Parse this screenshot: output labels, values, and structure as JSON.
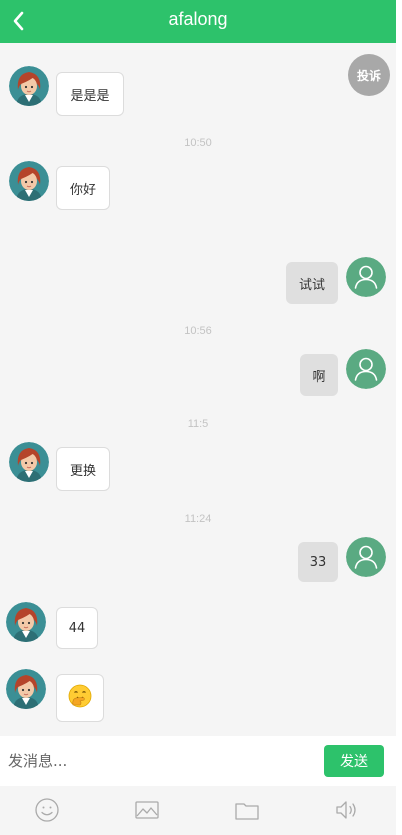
{
  "header": {
    "title": "afalong",
    "back_icon": "chevron-left-icon"
  },
  "complain_label": "投诉",
  "messages": [
    {
      "side": "in",
      "text": "是是是"
    },
    {
      "side": "in",
      "text": "你好"
    },
    {
      "side": "out",
      "text": "试试"
    },
    {
      "side": "out",
      "text": "啊"
    },
    {
      "side": "in",
      "text": "更换"
    },
    {
      "side": "out",
      "text": "33"
    },
    {
      "side": "in",
      "text": "44"
    },
    {
      "side": "in",
      "text": "🤭",
      "kind": "emoji"
    }
  ],
  "timestamps": [
    "10:50",
    "10:56",
    "11:5",
    "11:24"
  ],
  "input": {
    "placeholder": "发消息..."
  },
  "send_label": "发送",
  "toolbar": [
    "smile-icon",
    "image-icon",
    "folder-icon",
    "speaker-icon"
  ],
  "colors": {
    "accent": "#2dc26b",
    "complain": "#a8a8a8",
    "out_bubble": "#dfdfdf",
    "user_avatar": "#5aaa82"
  }
}
